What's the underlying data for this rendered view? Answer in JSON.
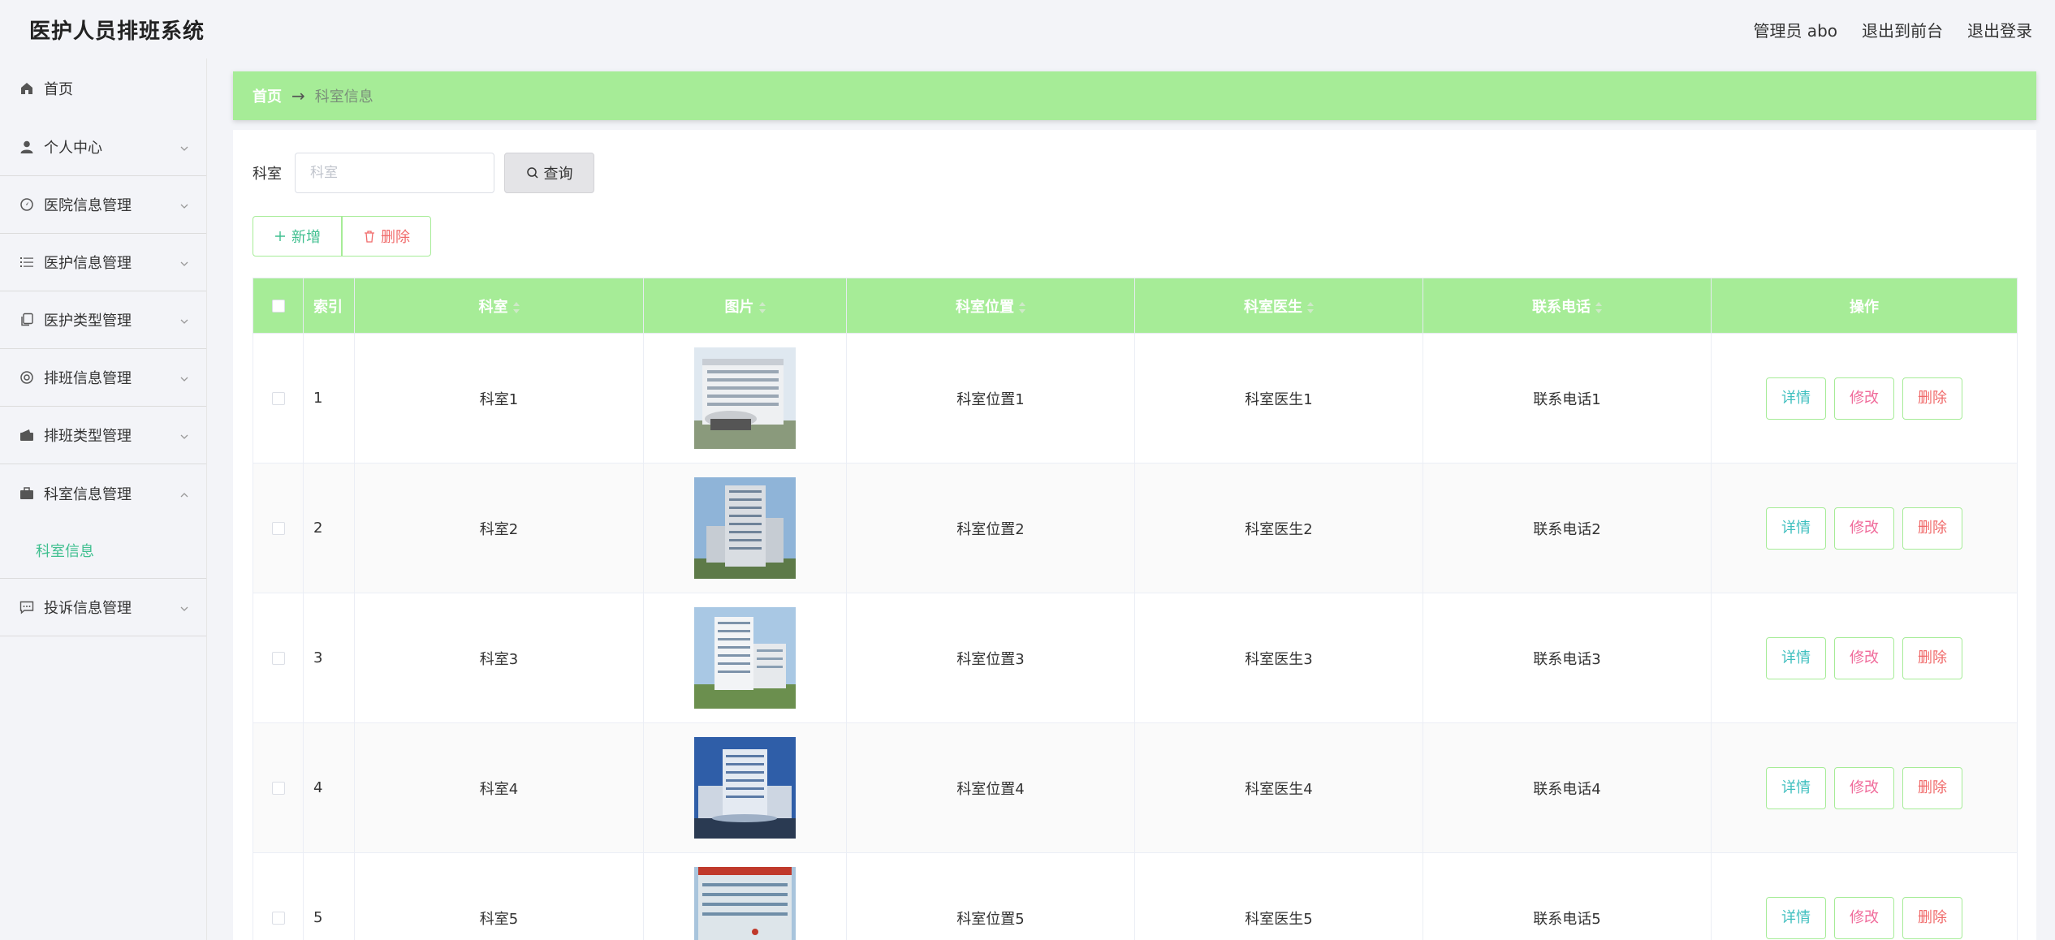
{
  "header": {
    "title": "医护人员排班系统",
    "admin": "管理员 abo",
    "front": "退出到前台",
    "logout": "退出登录"
  },
  "sidebar": {
    "items": [
      {
        "label": "首页",
        "icon": "home-icon"
      },
      {
        "label": "个人中心",
        "icon": "user-icon"
      },
      {
        "label": "医院信息管理",
        "icon": "compass-icon"
      },
      {
        "label": "医护信息管理",
        "icon": "list-icon"
      },
      {
        "label": "医护类型管理",
        "icon": "copy-icon"
      },
      {
        "label": "排班信息管理",
        "icon": "life-ring-icon"
      },
      {
        "label": "排班类型管理",
        "icon": "wallet-icon"
      },
      {
        "label": "科室信息管理",
        "icon": "briefcase-icon"
      },
      {
        "label": "投诉信息管理",
        "icon": "chat-icon"
      }
    ],
    "submenu": {
      "label": "科室信息"
    }
  },
  "breadcrumb": {
    "home": "首页",
    "current": "科室信息"
  },
  "search": {
    "label": "科室",
    "placeholder": "科室",
    "button": "查询"
  },
  "actions": {
    "add": "新增",
    "delete": "删除"
  },
  "table": {
    "headers": {
      "index": "索引",
      "dept": "科室",
      "image": "图片",
      "location": "科室位置",
      "doctor": "科室医生",
      "phone": "联系电话",
      "ops": "操作"
    },
    "row_buttons": {
      "detail": "详情",
      "edit": "修改",
      "delete": "删除"
    },
    "rows": [
      {
        "index": "1",
        "dept": "科室1",
        "location": "科室位置1",
        "doctor": "科室医生1",
        "phone": "联系电话1"
      },
      {
        "index": "2",
        "dept": "科室2",
        "location": "科室位置2",
        "doctor": "科室医生2",
        "phone": "联系电话2"
      },
      {
        "index": "3",
        "dept": "科室3",
        "location": "科室位置3",
        "doctor": "科室医生3",
        "phone": "联系电话3"
      },
      {
        "index": "4",
        "dept": "科室4",
        "location": "科室位置4",
        "doctor": "科室医生4",
        "phone": "联系电话4"
      },
      {
        "index": "5",
        "dept": "科室5",
        "location": "科室位置5",
        "doctor": "科室医生5",
        "phone": "联系电话5"
      }
    ]
  },
  "colors": {
    "accent_green": "#a6ec97",
    "link_teal": "#3fbf8f",
    "danger": "#f06a6a"
  }
}
